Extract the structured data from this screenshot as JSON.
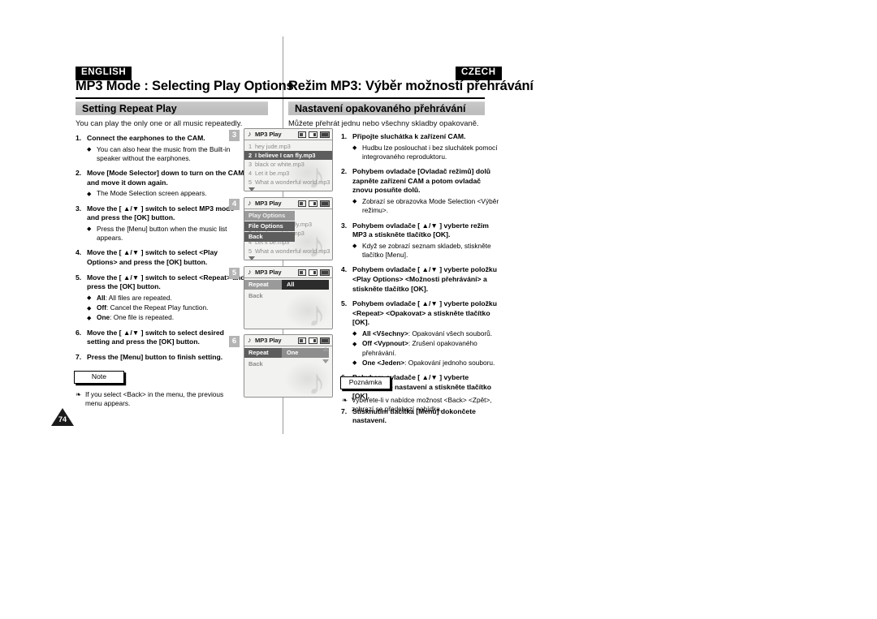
{
  "header": {
    "lang_left": "ENGLISH",
    "lang_right": "CZECH",
    "title_left": "MP3 Mode : Selecting Play Options",
    "title_right": "Režim MP3: Výběr možností přehrávání"
  },
  "section": {
    "left_heading": "Setting Repeat Play",
    "left_intro": "You can play the only one or all music repeatedly.",
    "right_heading": "Nastavení opakovaného přehrávání",
    "right_intro": "Můžete přehrát jednu nebo všechny skladby opakovaně."
  },
  "english_steps": [
    {
      "num": "1.",
      "text": "Connect the earphones to the CAM.",
      "bullets": [
        "You can also hear the music from the Built-in speaker without the earphones."
      ]
    },
    {
      "num": "2.",
      "text": "Move [Mode Selector] down to turn on the CAM and move it down again.",
      "bullets": [
        "The Mode Selection screen appears."
      ]
    },
    {
      "num": "3.",
      "text": "Move the [ ▲/▼ ] switch to select MP3 mode and press the [OK] button.",
      "bullets": [
        "Press the [Menu] button when the music list appears."
      ]
    },
    {
      "num": "4.",
      "text": "Move the [ ▲/▼ ] switch to select <Play Options> and press the [OK] button.",
      "bullets": []
    },
    {
      "num": "5.",
      "text": "Move the [ ▲/▼ ] switch to select <Repeat> and press the [OK] button.",
      "bullets": [
        "All: All files are repeated.",
        "Off: Cancel the Repeat Play function.",
        "One: One file is repeated."
      ],
      "bullet_bold": [
        "All",
        "Off",
        "One"
      ]
    },
    {
      "num": "6.",
      "text": "Move the [ ▲/▼ ] switch to select desired setting and press the [OK] button.",
      "bullets": []
    },
    {
      "num": "7.",
      "text": "Press the [Menu] button to finish setting.",
      "bullets": []
    }
  ],
  "czech_steps": [
    {
      "num": "1.",
      "text": "Připojte sluchátka k zařízení CAM.",
      "bullets": [
        "Hudbu lze poslouchat i bez sluchátek pomocí integrovaného reproduktoru."
      ]
    },
    {
      "num": "2.",
      "text": "Pohybem ovladače [Ovladač režimů] dolů zapněte zařízení CAM a potom ovladač znovu posuňte dolů.",
      "bullets": [
        "Zobrazí se obrazovka Mode Selection <Výběr režimu>."
      ]
    },
    {
      "num": "3.",
      "text": "Pohybem ovladače [ ▲/▼ ] vyberte režim MP3 a stiskněte tlačítko [OK].",
      "bullets": [
        "Když se zobrazí seznam skladeb, stiskněte tlačítko [Menu]."
      ]
    },
    {
      "num": "4.",
      "text": "Pohybem ovladače [ ▲/▼ ] vyberte položku <Play Options> <Možnosti přehrávání> a stiskněte tlačítko [OK].",
      "bullets": []
    },
    {
      "num": "5.",
      "text": "Pohybem ovladače [ ▲/▼ ] vyberte položku <Repeat> <Opakovat> a stiskněte tlačítko [OK].",
      "bullets": [
        "All <Všechny>: Opakování všech souborů.",
        "Off <Vypnout>: Zrušení opakovaného přehrávání.",
        "One <Jeden>: Opakování jednoho souboru."
      ],
      "bullet_bold": [
        "All <Všechny>",
        "Off <Vypnout>",
        "One <Jeden>"
      ]
    },
    {
      "num": "6.",
      "text": "Pohybem ovladače [ ▲/▼ ] vyberte požadované nastavení a stiskněte tlačítko [OK].",
      "bullets": []
    },
    {
      "num": "7.",
      "text": "Stisknutím tlačítka [Menu] dokončete nastavení.",
      "bullets": []
    }
  ],
  "notes": {
    "left_label": "Note",
    "left_text": "If you select <Back> in the menu, the previous menu appears.",
    "right_label": "Poznámka",
    "right_text": "Vyberete-li v nabídce možnost <Back> <Zpět>, zobrazí se předchozí nabídka."
  },
  "page_number": "74",
  "lcd_screens": [
    {
      "badge": "3",
      "title": "MP3 Play",
      "icons": [
        "memory-card-icon",
        "screen-icon",
        "battery-icon"
      ],
      "tracks": [
        {
          "num": "1",
          "name": "hey jude.mp3",
          "selected": false
        },
        {
          "num": "2",
          "name": "I believe I can fly.mp3",
          "selected": true
        },
        {
          "num": "3",
          "name": "black or white.mp3",
          "selected": false
        },
        {
          "num": "4",
          "name": "Let it be.mp3",
          "selected": false
        },
        {
          "num": "5",
          "name": "What a wonderful world.mp3",
          "selected": false
        }
      ],
      "scroll_down": true
    },
    {
      "badge": "4",
      "title": "MP3 Play",
      "icons": [
        "memory-card-icon",
        "screen-icon",
        "battery-icon"
      ],
      "menu_items": [
        {
          "label": "Play Options",
          "dim": true
        },
        {
          "label": "File Options",
          "dim": false
        },
        {
          "label": "Back",
          "dim": false
        }
      ],
      "tracks": [
        {
          "num": "1",
          "name": "hey jude.mp3",
          "selected": false
        },
        {
          "num": "2",
          "name": "I believe I can fly.mp3",
          "selected": false
        },
        {
          "num": "3",
          "name": "black or white.mp3",
          "selected": false
        },
        {
          "num": "4",
          "name": "Let it be.mp3",
          "selected": false
        },
        {
          "num": "5",
          "name": "What a wonderful world.mp3",
          "selected": false
        }
      ],
      "scroll_down": true
    },
    {
      "badge": "5",
      "title": "MP3 Play",
      "icons": [
        "memory-card-icon",
        "screen-icon",
        "battery-icon"
      ],
      "setting_label": "Repeat",
      "setting_value": "All",
      "back_label": "Back",
      "highlight": "grey"
    },
    {
      "badge": "6",
      "title": "MP3 Play",
      "icons": [
        "memory-card-icon",
        "screen-icon",
        "battery-icon"
      ],
      "setting_label": "Repeat",
      "setting_value": "One",
      "back_label": "Back",
      "highlight": "dark",
      "scroll_up_right": true,
      "scroll_down_right": true
    }
  ]
}
